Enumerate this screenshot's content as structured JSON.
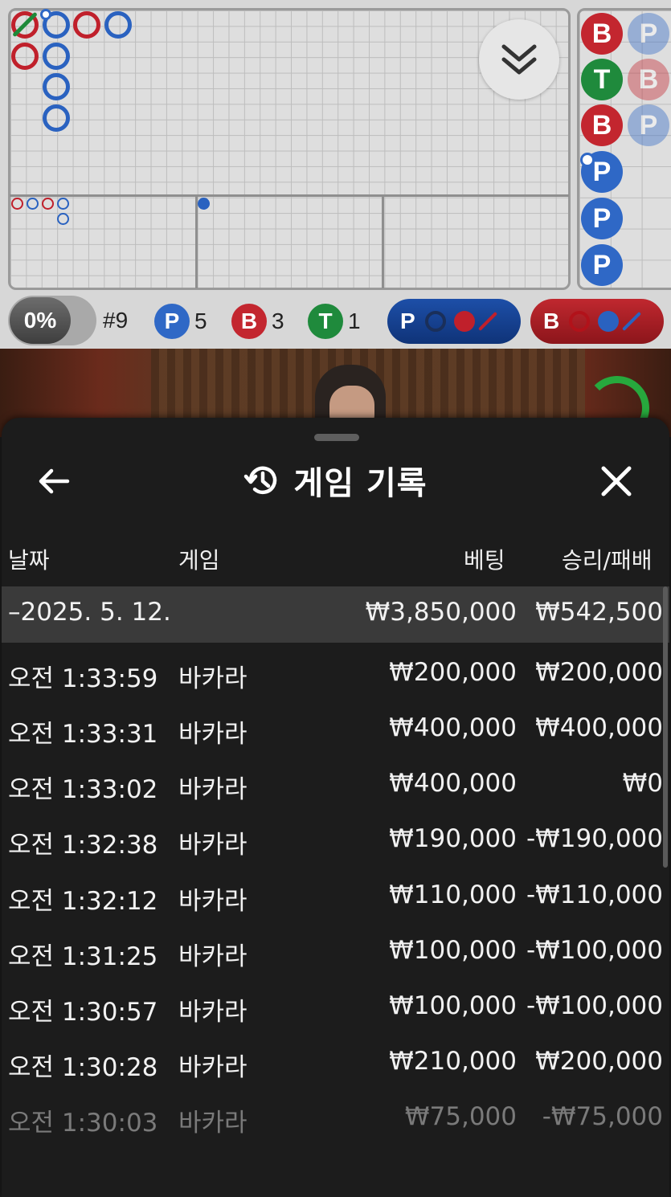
{
  "roadmap": {
    "stats": {
      "percent": "0%",
      "shoe": "#9",
      "player_label": "P",
      "player_count": "5",
      "banker_label": "B",
      "banker_count": "3",
      "tie_label": "T",
      "tie_count": "1"
    },
    "predict_player_label": "P",
    "predict_banker_label": "B",
    "bead_plate": [
      "B",
      "P",
      "T",
      "B",
      "B",
      "P",
      "P",
      "P",
      "P"
    ],
    "colors": {
      "banker": "#c3262f",
      "player": "#2f68c6",
      "tie": "#1f8a3c"
    },
    "video_timer": "7"
  },
  "sheet": {
    "title": "게임 기록",
    "icons": {
      "back": "arrow-left-icon",
      "history": "history-icon",
      "close": "close-icon"
    },
    "columns": {
      "date": "날짜",
      "game": "게임",
      "bet": "베팅",
      "result": "승리/패배"
    },
    "summary": {
      "date": "–2025. 5. 12.",
      "bet": "₩3,850,000",
      "result": "₩542,500"
    },
    "rows": [
      {
        "time": "오전 1:33:59",
        "game": "바카라",
        "bet": "₩200,000",
        "result": "₩200,000"
      },
      {
        "time": "오전 1:33:31",
        "game": "바카라",
        "bet": "₩400,000",
        "result": "₩400,000"
      },
      {
        "time": "오전 1:33:02",
        "game": "바카라",
        "bet": "₩400,000",
        "result": "₩0"
      },
      {
        "time": "오전 1:32:38",
        "game": "바카라",
        "bet": "₩190,000",
        "result": "-₩190,000"
      },
      {
        "time": "오전 1:32:12",
        "game": "바카라",
        "bet": "₩110,000",
        "result": "-₩110,000"
      },
      {
        "time": "오전 1:31:25",
        "game": "바카라",
        "bet": "₩100,000",
        "result": "-₩100,000"
      },
      {
        "time": "오전 1:30:57",
        "game": "바카라",
        "bet": "₩100,000",
        "result": "-₩100,000"
      },
      {
        "time": "오전 1:30:28",
        "game": "바카라",
        "bet": "₩210,000",
        "result": "₩200,000"
      },
      {
        "time": "오전 1:30:03",
        "game": "바카라",
        "bet": "₩75,000",
        "result": "-₩75,000"
      }
    ]
  }
}
